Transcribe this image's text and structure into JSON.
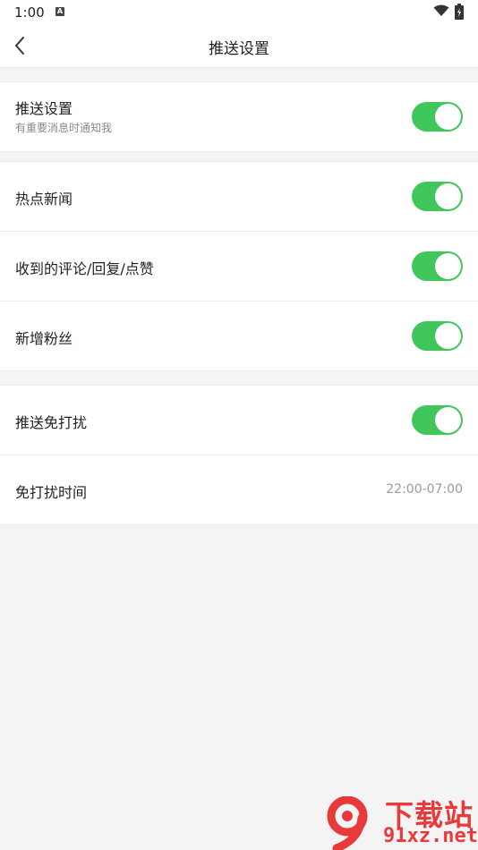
{
  "status_bar": {
    "time": "1:00",
    "notification_icon": "A"
  },
  "header": {
    "title": "推送设置"
  },
  "groups": [
    {
      "rows": [
        {
          "label": "推送设置",
          "sublabel": "有重要消息时通知我",
          "toggle_on": true
        }
      ]
    },
    {
      "rows": [
        {
          "label": "热点新闻",
          "toggle_on": true
        },
        {
          "label": "收到的评论/回复/点赞",
          "toggle_on": true
        },
        {
          "label": "新增粉丝",
          "toggle_on": true
        }
      ]
    },
    {
      "rows": [
        {
          "label": "推送免打扰",
          "toggle_on": true
        },
        {
          "label": "免打扰时间",
          "value": "22:00-07:00"
        }
      ]
    }
  ],
  "watermark": {
    "title": "下载站",
    "url": "91xz.net"
  },
  "colors": {
    "toggle_on": "#3fc75b",
    "background": "#f4f4f4",
    "watermark": "#e83a3a"
  }
}
